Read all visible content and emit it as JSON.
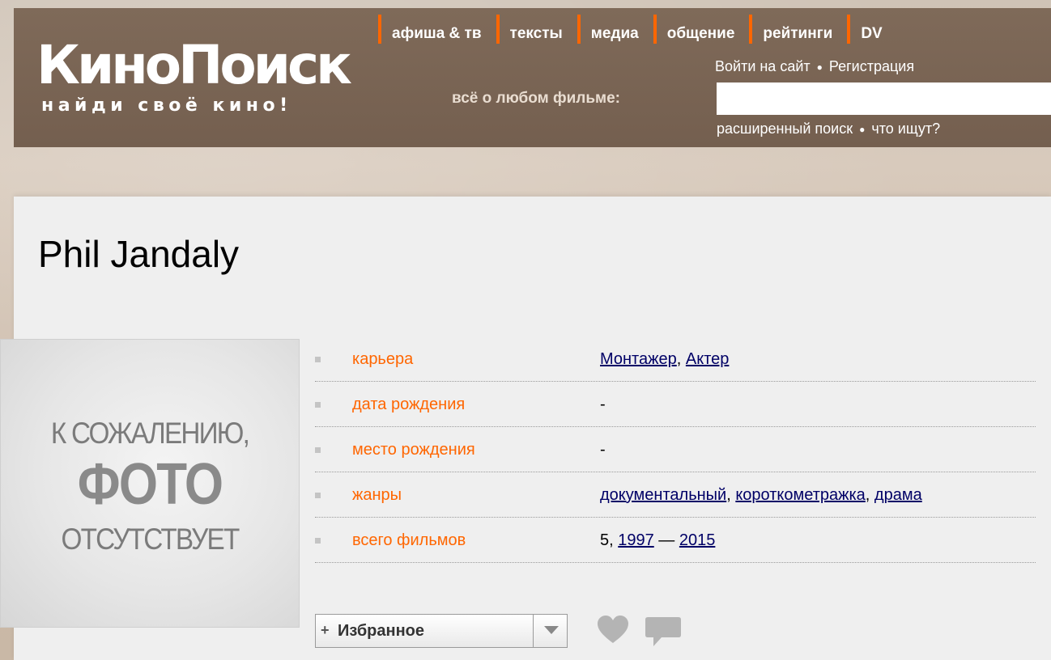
{
  "site": {
    "logo": "КиноПоиск",
    "slogan": "найди своё кино!",
    "tagline": "всё о любом фильме:"
  },
  "nav": {
    "items": [
      "афиша & тв",
      "тексты",
      "медиа",
      "общение",
      "рейтинги",
      "DV"
    ]
  },
  "auth": {
    "login": "Войти на сайт",
    "register": "Регистрация"
  },
  "search": {
    "value": "",
    "advanced": "расширенный поиск",
    "trending": "что ищут?"
  },
  "person": {
    "name": "Phil Jandaly",
    "photo_placeholder": {
      "line1": "К СОЖАЛЕНИЮ,",
      "line2": "ФОТО",
      "line3": "ОТСУТСТВУЕТ"
    },
    "info": [
      {
        "label": "карьера",
        "links": [
          "Монтажер",
          "Актер"
        ]
      },
      {
        "label": "дата рождения",
        "text": "-"
      },
      {
        "label": "место рождения",
        "text": "-"
      },
      {
        "label": "жанры",
        "links": [
          "документальный",
          "короткометражка",
          "драма"
        ]
      },
      {
        "label": "всего фильмов",
        "count": "5",
        "year_from": "1997",
        "year_to": "2015"
      }
    ]
  },
  "actions": {
    "favorites_plus": "+",
    "favorites": "Избранное"
  },
  "colors": {
    "accent": "#ff6600",
    "link": "#000066",
    "header_bg": "#7a6656"
  },
  "icons": [
    "heart-icon",
    "comment-icon",
    "chevron-down-icon"
  ]
}
